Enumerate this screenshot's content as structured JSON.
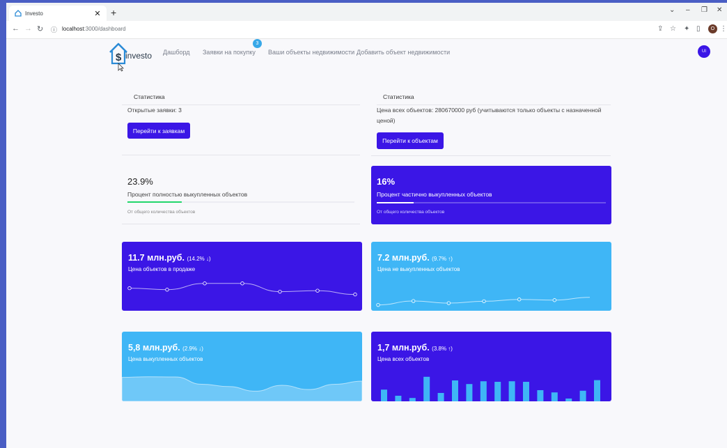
{
  "browser": {
    "tab_title": "Investo",
    "url_host": "localhost",
    "url_path": ":3000/dashboard",
    "profile_initial": "O"
  },
  "header": {
    "brand": "investo",
    "nav": [
      {
        "label": "Дашборд"
      },
      {
        "label": "Заявки на покупку"
      },
      {
        "label": "Ваши объекты недвижимости"
      },
      {
        "label": "Добавить объект недвижимости"
      }
    ],
    "requests_badge": "3",
    "avatar_initials": "UI"
  },
  "stats_left": {
    "heading": "Статистика",
    "text": "Открытые заявки: 3",
    "button": "Перейти к заявкам"
  },
  "stats_right": {
    "heading": "Статистика",
    "text": "Цена всех объектов: 280670000 руб (учитываются только объекты с назначенной ценой)",
    "button": "Перейти к объектам"
  },
  "percent_full": {
    "value": "23.9%",
    "label": "Процент полностью выкупленных объектов",
    "sub": "От общего количества объектов",
    "progress": 0.239,
    "bar_color": "#22d66b"
  },
  "percent_partial": {
    "value": "16%",
    "label": "Процент частично выкупленных объектов",
    "sub": "От общего количества объектов",
    "progress": 0.16
  },
  "cards": {
    "on_sale": {
      "value": "11.7 млн.руб.",
      "change": "(14.2% ↓)",
      "label": "Цена объектов в продаже"
    },
    "not_bought": {
      "value": "7.2 млн.руб.",
      "change": "(9.7% ↑)",
      "label": "Цена не выкупленных объектов"
    },
    "bought": {
      "value": "5,8 млн.руб.",
      "change": "(2.9% ↓)",
      "label": "Цена выкупленных объектов"
    },
    "all": {
      "value": "1,7 млн.руб.",
      "change": "(3.8% ↑)",
      "label": "Цена всех объектов"
    }
  },
  "colors": {
    "primary": "#3b16e6",
    "info": "#3fb6f6"
  },
  "chart_data": [
    {
      "type": "line",
      "values": [
        65,
        59,
        84,
        84,
        51,
        55,
        40
      ]
    },
    {
      "type": "line",
      "values": [
        1,
        18,
        9,
        17,
        25,
        22,
        34
      ]
    },
    {
      "type": "area",
      "values": [
        78,
        81,
        80,
        45,
        34,
        12,
        40,
        20,
        45,
        60
      ]
    },
    {
      "type": "bar",
      "values": [
        42,
        20,
        12,
        88,
        30,
        75,
        62,
        72,
        70,
        72,
        70,
        40,
        32,
        10,
        38,
        76
      ]
    }
  ]
}
